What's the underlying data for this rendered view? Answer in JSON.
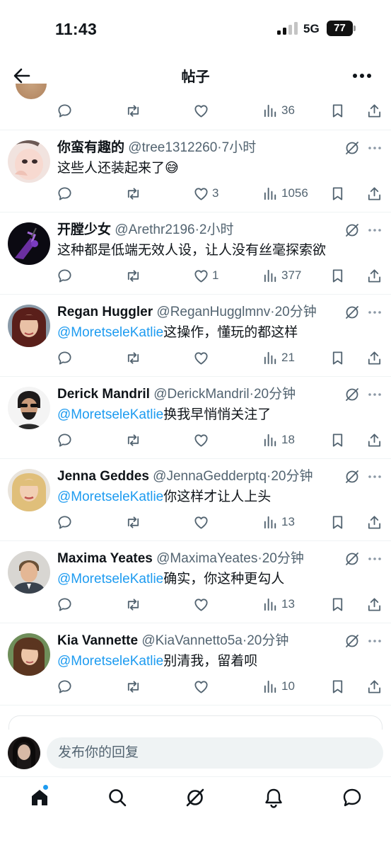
{
  "status_bar": {
    "time": "11:43",
    "network": "5G",
    "battery": "77"
  },
  "header": {
    "title": "帖子"
  },
  "top_post": {
    "views": "36"
  },
  "replies": [
    {
      "name": "你蛮有趣的",
      "handle": "@tree1312260",
      "time": "7小时",
      "mention": "",
      "text": "这些人还装起来了😅",
      "likes": "3",
      "views": "1056"
    },
    {
      "name": "开膛少女",
      "handle": "@Arethr2196",
      "time": "2小时",
      "mention": "",
      "text": "这种都是低端无效人设，让人没有丝毫探索欲",
      "likes": "1",
      "views": "377"
    },
    {
      "name": "Regan Huggler",
      "handle": "@ReganHugglmnv",
      "time": "20分钟",
      "mention": "@MoretseleKatlie",
      "text": "这操作，懂玩的都这样",
      "likes": "",
      "views": "21"
    },
    {
      "name": "Derick Mandril",
      "handle": "@DerickMandril",
      "time": "20分钟",
      "mention": "@MoretseleKatlie",
      "text": "换我早悄悄关注了",
      "likes": "",
      "views": "18"
    },
    {
      "name": "Jenna Geddes",
      "handle": "@JennaGedderptq",
      "time": "20分钟",
      "mention": "@MoretseleKatlie",
      "text": "你这样才让人上头",
      "likes": "",
      "views": "13"
    },
    {
      "name": "Maxima Yeates",
      "handle": "@MaximaYeates",
      "time": "20分钟",
      "mention": "@MoretseleKatlie",
      "text": "确实，你这种更勾人",
      "likes": "",
      "views": "13"
    },
    {
      "name": "Kia Vannette",
      "handle": "@KiaVannetto5a",
      "time": "20分钟",
      "mention": "@MoretseleKatlie",
      "text": "别清我，留着呗",
      "likes": "",
      "views": "10"
    }
  ],
  "composer": {
    "placeholder": "发布你的回复"
  },
  "colors": {
    "accent": "#1d9bf0",
    "text": "#0f1419",
    "muted": "#536471",
    "divider": "#eff3f4"
  }
}
